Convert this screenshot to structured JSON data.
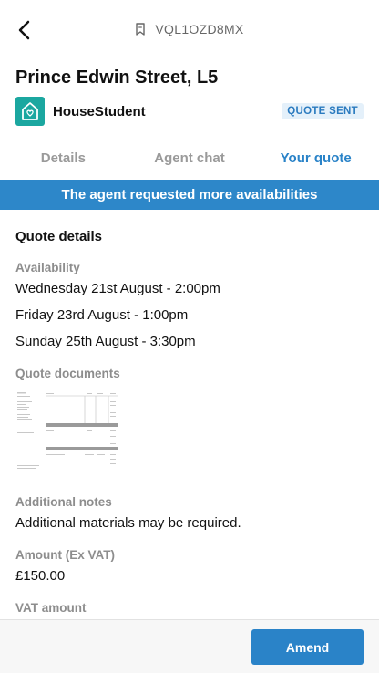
{
  "header": {
    "back_icon": "chevron-left-icon",
    "ref_icon": "bookmark-icon",
    "reference": "VQL1OZD8MX"
  },
  "property": {
    "title": "Prince Edwin Street, L5"
  },
  "agent": {
    "logo_icon": "house-heart-icon",
    "logo_color": "#1ba7a0",
    "name": "HouseStudent",
    "status": "QUOTE SENT"
  },
  "tabs": [
    {
      "label": "Details",
      "active": false
    },
    {
      "label": "Agent chat",
      "active": false
    },
    {
      "label": "Your quote",
      "active": true
    }
  ],
  "banner": {
    "text": "The agent requested more availabilities",
    "color": "#2d87c9"
  },
  "quote": {
    "section_title": "Quote details",
    "availability_label": "Availability",
    "availability": [
      "Wednesday 21st August - 2:00pm",
      "Friday 23rd August - 1:00pm",
      "Sunday 25th August - 3:30pm"
    ],
    "documents_label": "Quote documents",
    "notes_label": "Additional notes",
    "notes": "Additional materials may be required.",
    "amount_label": "Amount (Ex VAT)",
    "amount": "£150.00",
    "vat_label": "VAT amount"
  },
  "footer": {
    "amend_label": "Amend",
    "accent": "#2a83c8"
  }
}
